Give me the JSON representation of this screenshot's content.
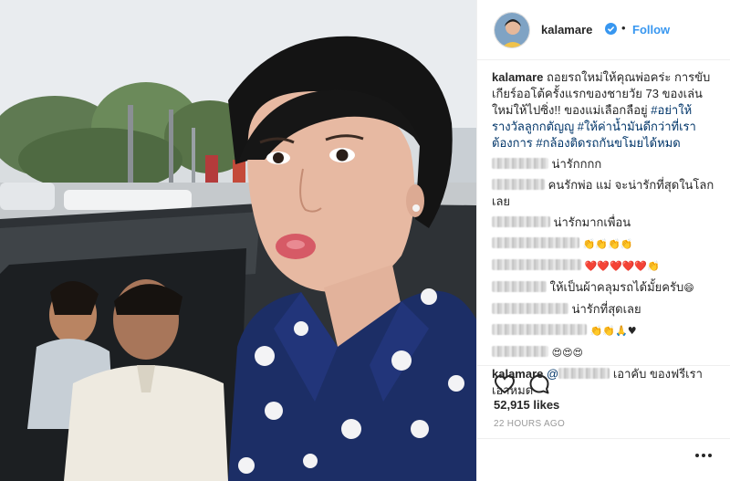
{
  "post": {
    "username": "kalamare",
    "follow_label": "Follow",
    "separator": "•",
    "caption_user": "kalamare",
    "caption_text": "ถอยรถใหม่ให้คุณพ่อคร่ะ การขับเกียร์ออโต้ครั้งแรกของชายวัย 73 ของเล่นใหม่ให้ไปซิ่ง!! ของแม่เลือกลือยู่ ",
    "caption_tags": "#อย่าให้รางวัลลูกกตัญญู #ให้ค่าน้ำมันดีกว่าที่เราต้องการ #กล้องติดรถกันขโมยได้หมด"
  },
  "comments": [
    {
      "text": "น่ารักกกก",
      "emoji": ""
    },
    {
      "text": "คนรักพ่อ แม่ จะน่ารักที่สุดในโลกเลย",
      "emoji": ""
    },
    {
      "text": "น่ารักมากเพื่อน",
      "emoji": ""
    },
    {
      "text": "",
      "emoji": "👏👏👏👏"
    },
    {
      "text": "",
      "emoji": "❤️❤️❤️❤️❤️👏"
    },
    {
      "text": "ให้เป็นผ้าคลุมรถได้มั้ยครับ",
      "emoji": "😄"
    },
    {
      "text": "น่ารักที่สุดเลย",
      "emoji": ""
    },
    {
      "text": "",
      "emoji": "👏👏🙏♥"
    },
    {
      "text": "",
      "emoji": "😍😍😍"
    }
  ],
  "reply": {
    "user": "kalamare",
    "at": "@",
    "text": " เอาคับ ของฟรีเราเอาหมด"
  },
  "icons": {
    "like": "heart-icon",
    "comment": "comment-bubble-icon",
    "more": "more-options-icon",
    "verified": "verified-badge-icon"
  },
  "stats": {
    "likes": "52,915 likes",
    "time": "22 HOURS AGO"
  },
  "colors": {
    "link_blue": "#3897f0",
    "hashtag": "#003569",
    "text": "#262626",
    "muted": "#999999"
  }
}
